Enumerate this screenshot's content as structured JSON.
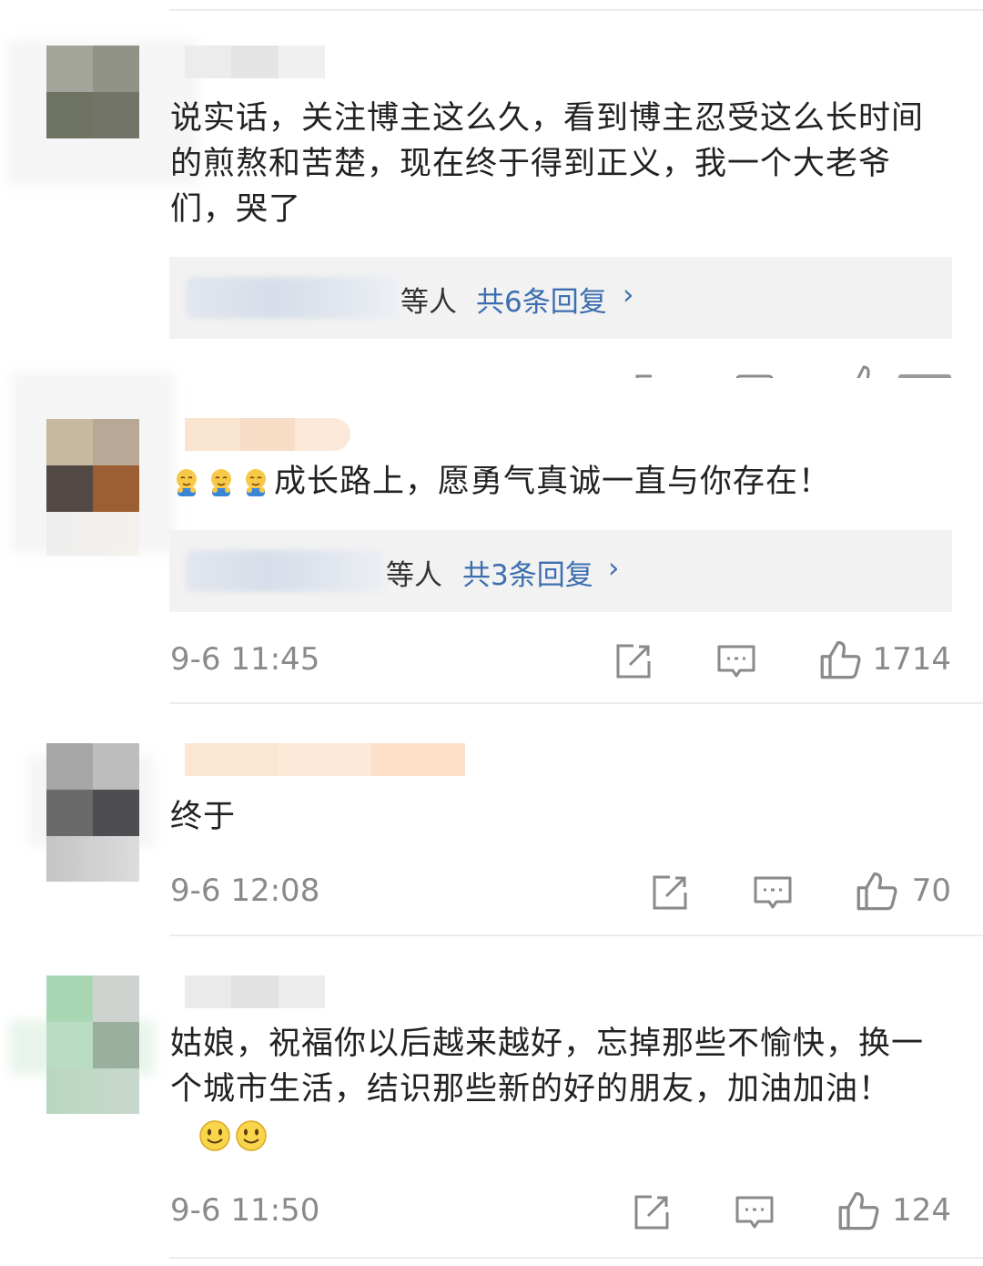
{
  "comments": [
    {
      "text": "说实话，关注博主这么久，看到博主忍受这么长时间的煎熬和苦楚，现在终于得到正义，我一个大老爷们，哭了",
      "replies_suffix": "等人",
      "replies_count": "共6条回复",
      "chevron": "›",
      "time": "",
      "likes": "",
      "avatar_colors": [
        "#a3a59a",
        "#909286",
        "#6f7362",
        "#717467"
      ]
    },
    {
      "text": "成长路上，愿勇气真诚一直与你存在！",
      "emoji_prefix": [
        "crying-face-emoji",
        "crying-face-emoji",
        "crying-face-emoji"
      ],
      "replies_suffix": "等人",
      "replies_count": "共3条回复",
      "chevron": "›",
      "time": "9-6 11:45",
      "likes": "1714",
      "avatar_colors": [
        "#c8b89f",
        "#b8a996",
        "#524945",
        "#9c5e33"
      ]
    },
    {
      "text": "终于",
      "time": "9-6 12:08",
      "likes": "70",
      "avatar_colors": [
        "#a6a6a6",
        "#bdbdbd",
        "#6a6a6a",
        "#4e4d52"
      ]
    },
    {
      "text": "姑娘，祝福你以后越来越好，忘掉那些不愉快，换一个城市生活，结识那些新的好的朋友，加油加油！",
      "emoji_suffix": [
        "smile-emoji",
        "smile-emoji"
      ],
      "time": "9-6 11:50",
      "likes": "124",
      "avatar_colors": [
        "#a9d7b4",
        "#cfd3d0",
        "#b9dcc2",
        "#9aaf9e"
      ]
    }
  ],
  "colors": {
    "reply_link": "#3d6fb0",
    "meta_text": "#8a8a8a",
    "reply_box_bg": "#f2f2f2"
  },
  "icons": [
    "share-icon",
    "comment-icon",
    "like-icon"
  ]
}
